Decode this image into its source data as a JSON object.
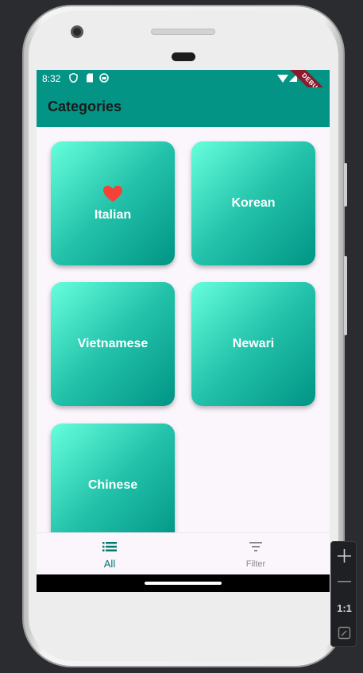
{
  "status_bar": {
    "time": "8:32",
    "icons": [
      "shield-icon",
      "sd-card-icon",
      "android-icon",
      "wifi-icon",
      "signal-icon"
    ],
    "debug_banner": "DEBUG"
  },
  "app_bar": {
    "title": "Categories",
    "color": "#039485"
  },
  "categories": [
    {
      "label": "Italian",
      "favorite": true
    },
    {
      "label": "Korean",
      "favorite": false
    },
    {
      "label": "Vietnamese",
      "favorite": false
    },
    {
      "label": "Newari",
      "favorite": false
    },
    {
      "label": "Chinese",
      "favorite": false
    }
  ],
  "card_gradient": {
    "from": "#66ffdd",
    "to": "#009485"
  },
  "heart_color": "#f44336",
  "bottom_nav": {
    "items": [
      {
        "label": "All",
        "icon": "list-icon",
        "selected": true
      },
      {
        "label": "Filter",
        "icon": "filter-icon",
        "selected": false
      }
    ],
    "selected_color": "#00796b",
    "unselected_color": "#8a8a8a"
  },
  "emulator_toolbar": {
    "zoom_label": "1:1",
    "buttons": [
      "zoom-in-icon",
      "zoom-out-icon",
      "actual-size-label",
      "fit-screen-icon"
    ]
  }
}
